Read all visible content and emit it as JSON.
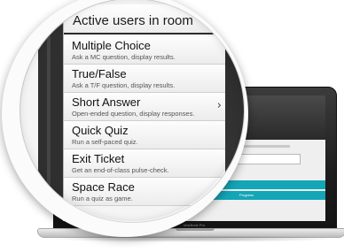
{
  "menu": {
    "header": "Active users in room",
    "items": [
      {
        "title": "Multiple Choice",
        "subtitle": "Ask a MC question, display results.",
        "has_chevron": false
      },
      {
        "title": "True/False",
        "subtitle": "Ask a T/F question, display results.",
        "has_chevron": false
      },
      {
        "title": "Short Answer",
        "subtitle": "Open-ended question, display responses.",
        "has_chevron": true
      },
      {
        "title": "Quick Quiz",
        "subtitle": "Run a self-paced quiz.",
        "has_chevron": false
      },
      {
        "title": "Exit Ticket",
        "subtitle": "Get an end-of-class pulse-check.",
        "has_chevron": false
      },
      {
        "title": "Space Race",
        "subtitle": "Run a quiz as game.",
        "has_chevron": false
      }
    ],
    "chevron_icon": "chevron-right-icon",
    "chevron_glyph": "›"
  },
  "laptop": {
    "screen_word": "e",
    "bar_text": "Progress",
    "brand": "MacBook Pro"
  },
  "colors": {
    "accent": "#13a6b6",
    "dark": "#2f2f2f",
    "menu_bg": "#f5f5f5"
  }
}
